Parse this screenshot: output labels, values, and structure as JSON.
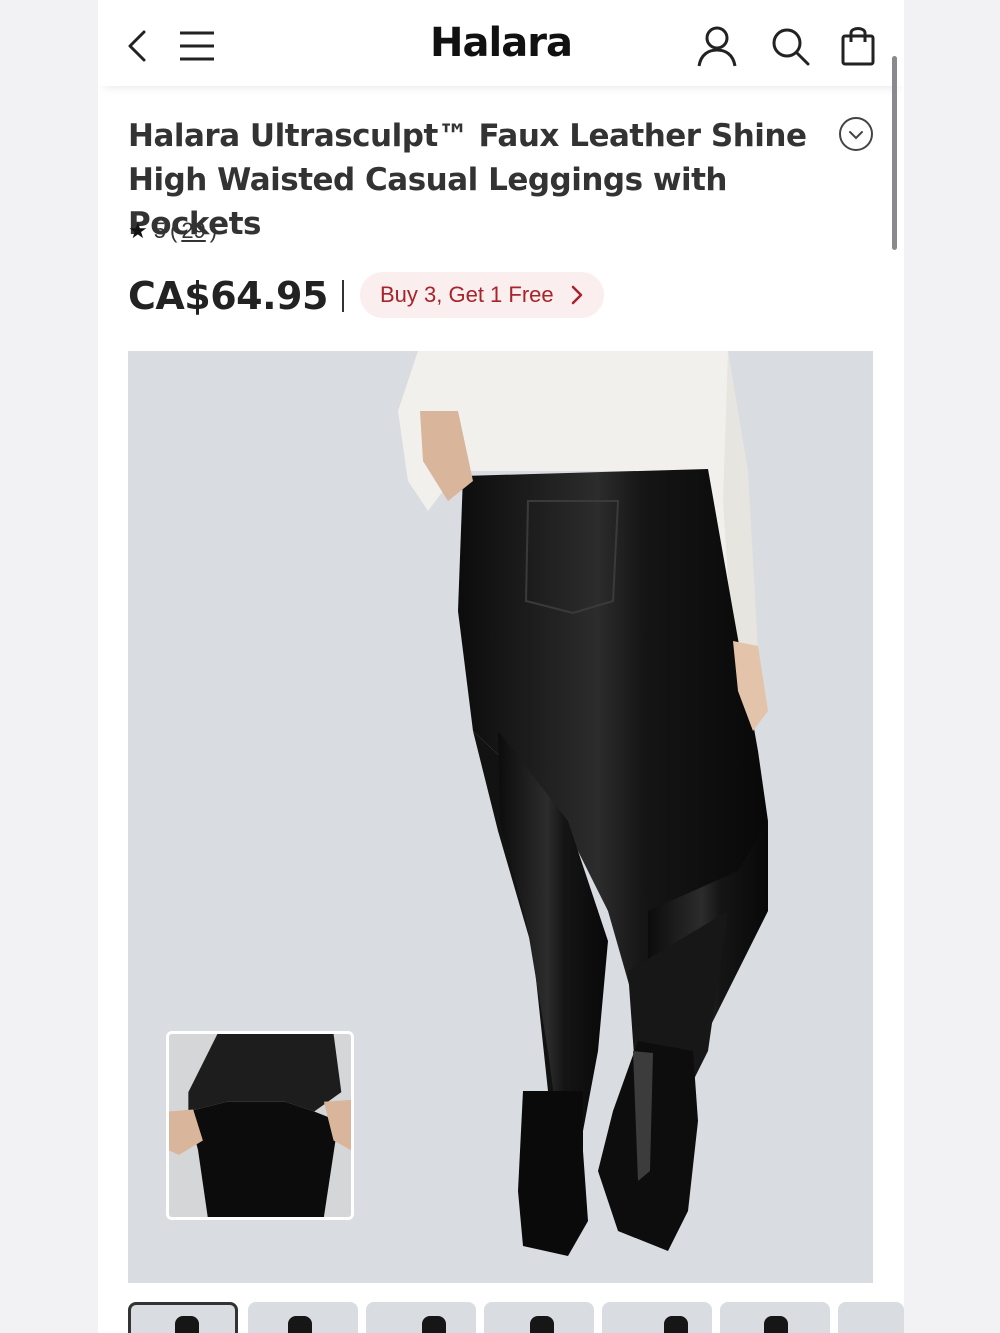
{
  "header": {
    "logo": "Halara",
    "icons": [
      "back-icon",
      "menu-icon",
      "account-icon",
      "search-icon",
      "shopping-bag-icon"
    ]
  },
  "product": {
    "title": "Halara Ultrasculpt™ Faux Leather Shine High Waisted Casual Leggings with Pockets",
    "rating": "5",
    "review_open": "(",
    "review_count": "29",
    "review_close": ")",
    "price": "CA$64.95",
    "promo_label": "Buy 3, Get 1 Free"
  },
  "gallery": {
    "thumbnail_count": 7,
    "active_index": 0
  },
  "colors": {
    "promo_text": "#a8232a",
    "promo_bg": "#fbeeee",
    "image_bg": "#d9dce0"
  }
}
